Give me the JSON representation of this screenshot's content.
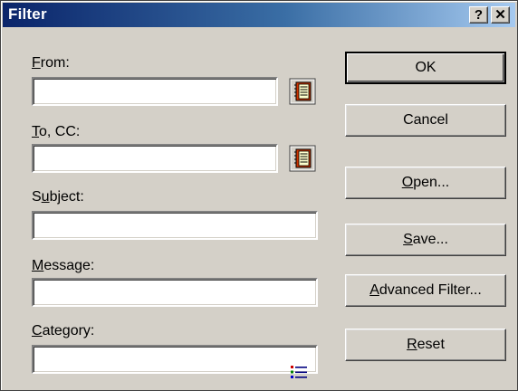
{
  "window": {
    "title": "Filter",
    "help_btn": "?",
    "close_btn": "✕"
  },
  "fields": {
    "from": {
      "pre": "",
      "mn": "F",
      "post": "rom:",
      "value": ""
    },
    "to": {
      "pre": "",
      "mn": "T",
      "post": "o, CC:",
      "value": ""
    },
    "subject": {
      "pre": "S",
      "mn": "u",
      "post": "bject:",
      "value": ""
    },
    "message": {
      "pre": "",
      "mn": "M",
      "post": "essage:",
      "value": ""
    },
    "category": {
      "pre": "",
      "mn": "C",
      "post": "ategory:",
      "value": ""
    }
  },
  "buttons": {
    "ok": {
      "pre": "OK",
      "mn": "",
      "post": ""
    },
    "cancel": {
      "pre": "Cancel",
      "mn": "",
      "post": ""
    },
    "open": {
      "pre": "",
      "mn": "O",
      "post": "pen..."
    },
    "save": {
      "pre": "",
      "mn": "S",
      "post": "ave..."
    },
    "advanced": {
      "pre": "",
      "mn": "A",
      "post": "dvanced Filter..."
    },
    "reset": {
      "pre": "",
      "mn": "R",
      "post": "eset"
    }
  },
  "icons": {
    "address_book": "address-book-icon",
    "category_list": "category-list-icon"
  },
  "colors": {
    "title_start": "#0a246a",
    "title_end": "#a6caf0",
    "face": "#d4d0c8"
  }
}
